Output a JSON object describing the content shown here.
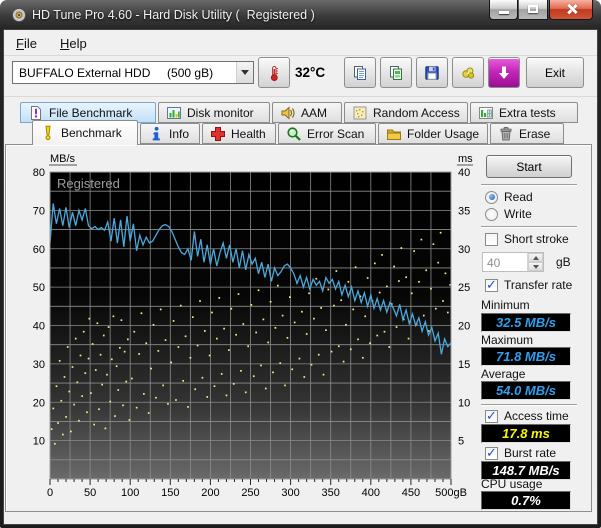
{
  "window": {
    "title": "HD Tune Pro 4.60 - Hard Disk Utility (  Registered )"
  },
  "menu": {
    "items": [
      {
        "label": "File"
      },
      {
        "label": "Help"
      }
    ]
  },
  "toolbar": {
    "drive_select": {
      "value": "BUFFALO External HDD     (500 gB)"
    },
    "temperature": "32°C",
    "exit_label": "Exit",
    "icons": [
      "thermometer-icon",
      "copy-icon",
      "copy-image-icon",
      "save-icon",
      "tools-icon",
      "download-icon"
    ]
  },
  "tabs_row1": [
    {
      "label": "File Benchmark",
      "icon": "file-benchmark-icon",
      "highlighted": true
    },
    {
      "label": "Disk monitor",
      "icon": "disk-monitor-icon"
    },
    {
      "label": "AAM",
      "icon": "speaker-icon"
    },
    {
      "label": "Random Access",
      "icon": "random-access-icon"
    },
    {
      "label": "Extra tests",
      "icon": "extra-tests-icon"
    }
  ],
  "tabs_row2": [
    {
      "label": "Benchmark",
      "icon": "exclamation-icon",
      "active": true
    },
    {
      "label": "Info",
      "icon": "info-icon"
    },
    {
      "label": "Health",
      "icon": "health-cross-icon"
    },
    {
      "label": "Error Scan",
      "icon": "magnifier-icon"
    },
    {
      "label": "Folder Usage",
      "icon": "folder-icon"
    },
    {
      "label": "Erase",
      "icon": "trash-icon"
    }
  ],
  "panel": {
    "start_label": "Start",
    "read_label": "Read",
    "write_label": "Write",
    "short_stroke_label": "Short stroke",
    "short_stroke_value": "40",
    "short_stroke_unit": "gB",
    "transfer_rate_label": "Transfer rate",
    "minimum_label": "Minimum",
    "minimum_value": "32.5 MB/s",
    "maximum_label": "Maximum",
    "maximum_value": "71.8 MB/s",
    "average_label": "Average",
    "average_value": "54.0 MB/s",
    "access_time_label": "Access time",
    "access_time_value": "17.8 ms",
    "burst_rate_label": "Burst rate",
    "burst_rate_value": "148.7 MB/s",
    "cpu_usage_label": "CPU usage",
    "cpu_usage_value": "0.7%"
  },
  "chart_data": {
    "type": "line+scatter",
    "watermark": "Registered",
    "left_axis": {
      "label": "MB/s",
      "min": 0,
      "max": 80,
      "ticks": [
        80,
        70,
        60,
        50,
        40,
        30,
        20,
        10
      ],
      "grid_step": 5
    },
    "right_axis": {
      "label": "ms",
      "min": 0,
      "max": 40,
      "ticks": [
        40,
        35,
        30,
        25,
        20,
        15,
        10,
        5
      ]
    },
    "x_axis": {
      "min": 0,
      "max": 500,
      "major_ticks": [
        0,
        50,
        100,
        150,
        200,
        250,
        300,
        350,
        400,
        450,
        500
      ],
      "labels": [
        "0",
        "50",
        "100",
        "150",
        "200",
        "250",
        "300",
        "350",
        "400",
        "450",
        "500gB"
      ],
      "minor_step": 10,
      "grid_step": 25
    },
    "series": [
      {
        "name": "transfer_rate",
        "type": "line",
        "axis": "left",
        "color": "#4aa9dd",
        "x_step": 4,
        "values": [
          61.5,
          71.8,
          66.5,
          70.5,
          66,
          70.8,
          65.5,
          69.5,
          66,
          70,
          67.5,
          70.5,
          66,
          65.2,
          65.8,
          65,
          65.5,
          64.8,
          67,
          62,
          68,
          61.5,
          67.5,
          60.5,
          68.5,
          62,
          66.5,
          59.5,
          63.5,
          61,
          63,
          61.5,
          62,
          63.5,
          65,
          66,
          66.3,
          65.8,
          64.5,
          62.5,
          60.5,
          59,
          58.5,
          60,
          57,
          64.5,
          58,
          62.5,
          56.5,
          61,
          56,
          60,
          55.5,
          59,
          61.5,
          57.5,
          61,
          56.5,
          60,
          55,
          59.5,
          54.5,
          58.5,
          56,
          57.5,
          53.5,
          56.5,
          52.5,
          56,
          51.5,
          55,
          53,
          54,
          55.5,
          56,
          55,
          53.5,
          51,
          53,
          50,
          52.5,
          49.5,
          52,
          50.5,
          51.5,
          49,
          52.5,
          51,
          52,
          49.5,
          51.5,
          48,
          50.5,
          47.5,
          50,
          46.5,
          49,
          46,
          48.5,
          45,
          48,
          44.5,
          47,
          44,
          46.5,
          43.5,
          46,
          44.5,
          42.5,
          45.5,
          41.5,
          44,
          40.5,
          43,
          40,
          42,
          38.5,
          41,
          37.5,
          39.5,
          36,
          38,
          32.5,
          36.5,
          34.5,
          35.5
        ]
      },
      {
        "name": "access_time",
        "type": "scatter",
        "axis": "right",
        "color": "#f2ee86",
        "points": [
          [
            2,
            6.5
          ],
          [
            4,
            9.2
          ],
          [
            6,
            4.6
          ],
          [
            8,
            12.1
          ],
          [
            10,
            7.3
          ],
          [
            12,
            15.4
          ],
          [
            14,
            10.2
          ],
          [
            16,
            5.8
          ],
          [
            18,
            13.3
          ],
          [
            20,
            8.1
          ],
          [
            22,
            17.2
          ],
          [
            24,
            11.4
          ],
          [
            26,
            6.2
          ],
          [
            28,
            14.6
          ],
          [
            30,
            9.7
          ],
          [
            32,
            18.3
          ],
          [
            34,
            12.6
          ],
          [
            36,
            7.6
          ],
          [
            38,
            16.1
          ],
          [
            40,
            10.8
          ],
          [
            42,
            19.2
          ],
          [
            44,
            13.8
          ],
          [
            46,
            8.7
          ],
          [
            48,
            15.7
          ],
          [
            49,
            20.9
          ],
          [
            51,
            11.2
          ],
          [
            53,
            17.6
          ],
          [
            55,
            7.1
          ],
          [
            57,
            14.2
          ],
          [
            59,
            20.3
          ],
          [
            61,
            9.1
          ],
          [
            63,
            16.2
          ],
          [
            65,
            12.3
          ],
          [
            67,
            18.7
          ],
          [
            69,
            6.6
          ],
          [
            71,
            13.6
          ],
          [
            73,
            19.8
          ],
          [
            75,
            10.1
          ],
          [
            77,
            15.6
          ],
          [
            79,
            21.2
          ],
          [
            81,
            8.2
          ],
          [
            83,
            14.7
          ],
          [
            85,
            11.6
          ],
          [
            87,
            17.1
          ],
          [
            89,
            20.7
          ],
          [
            91,
            9.6
          ],
          [
            93,
            16.6
          ],
          [
            95,
            12.7
          ],
          [
            97,
            18.2
          ],
          [
            99,
            7.7
          ],
          [
            102,
            13.1
          ],
          [
            105,
            19.2
          ],
          [
            108,
            9.3
          ],
          [
            111,
            16.3
          ],
          [
            114,
            21.6
          ],
          [
            117,
            11.1
          ],
          [
            120,
            17.7
          ],
          [
            123,
            8.6
          ],
          [
            126,
            14.4
          ],
          [
            129,
            20.1
          ],
          [
            132,
            10.6
          ],
          [
            135,
            16.7
          ],
          [
            138,
            22.1
          ],
          [
            141,
            12.2
          ],
          [
            144,
            18.1
          ],
          [
            147,
            9.8
          ],
          [
            151,
            15.2
          ],
          [
            154,
            20.6
          ],
          [
            157,
            10.3
          ],
          [
            160,
            17.2
          ],
          [
            163,
            22.6
          ],
          [
            166,
            12.8
          ],
          [
            169,
            18.6
          ],
          [
            172,
            9.4
          ],
          [
            175,
            15.8
          ],
          [
            178,
            21.1
          ],
          [
            181,
            11.7
          ],
          [
            184,
            17.4
          ],
          [
            187,
            23.2
          ],
          [
            190,
            13.2
          ],
          [
            193,
            19.3
          ],
          [
            196,
            10.7
          ],
          [
            199,
            16.1
          ],
          [
            202,
            21.7
          ],
          [
            205,
            12.1
          ],
          [
            208,
            18.3
          ],
          [
            211,
            23.6
          ],
          [
            214,
            13.7
          ],
          [
            217,
            19.6
          ],
          [
            220,
            10.9
          ],
          [
            223,
            16.8
          ],
          [
            226,
            22.2
          ],
          [
            229,
            12.4
          ],
          [
            232,
            18.8
          ],
          [
            235,
            24.1
          ],
          [
            238,
            14.1
          ],
          [
            241,
            20.2
          ],
          [
            244,
            11.3
          ],
          [
            247,
            17.3
          ],
          [
            251,
            22.7
          ],
          [
            254,
            13.4
          ],
          [
            257,
            19.1
          ],
          [
            260,
            24.6
          ],
          [
            263,
            14.8
          ],
          [
            266,
            20.8
          ],
          [
            269,
            11.8
          ],
          [
            272,
            17.8
          ],
          [
            275,
            23.1
          ],
          [
            278,
            13.9
          ],
          [
            281,
            19.7
          ],
          [
            284,
            25.2
          ],
          [
            287,
            15.1
          ],
          [
            290,
            21.3
          ],
          [
            293,
            12.2
          ],
          [
            296,
            18.4
          ],
          [
            299,
            23.7
          ],
          [
            302,
            14.3
          ],
          [
            305,
            20.4
          ],
          [
            308,
            25.6
          ],
          [
            311,
            15.7
          ],
          [
            314,
            21.8
          ],
          [
            317,
            13.3
          ],
          [
            320,
            18.9
          ],
          [
            323,
            24.2
          ],
          [
            326,
            14.9
          ],
          [
            329,
            20.9
          ],
          [
            332,
            26.1
          ],
          [
            335,
            16.2
          ],
          [
            338,
            22.3
          ],
          [
            341,
            13.6
          ],
          [
            344,
            19.4
          ],
          [
            347,
            24.7
          ],
          [
            351,
            16.6
          ],
          [
            354,
            22.6
          ],
          [
            357,
            27.1
          ],
          [
            360,
            17.3
          ],
          [
            363,
            23.3
          ],
          [
            366,
            15.3
          ],
          [
            369,
            20.1
          ],
          [
            372,
            25.7
          ],
          [
            375,
            16.9
          ],
          [
            378,
            22.1
          ],
          [
            381,
            27.6
          ],
          [
            384,
            18.2
          ],
          [
            387,
            23.8
          ],
          [
            390,
            15.8
          ],
          [
            393,
            21.2
          ],
          [
            396,
            26.2
          ],
          [
            399,
            17.7
          ],
          [
            402,
            23.2
          ],
          [
            405,
            28.1
          ],
          [
            408,
            18.7
          ],
          [
            411,
            24.3
          ],
          [
            414,
            29.2
          ],
          [
            417,
            19.2
          ],
          [
            420,
            25.1
          ],
          [
            423,
            17.2
          ],
          [
            426,
            22.8
          ],
          [
            429,
            27.7
          ],
          [
            432,
            19.8
          ],
          [
            435,
            25.8
          ],
          [
            438,
            30.1
          ],
          [
            441,
            20.8
          ],
          [
            444,
            26.3
          ],
          [
            447,
            18.3
          ],
          [
            451,
            24.2
          ],
          [
            454,
            29.7
          ],
          [
            457,
            20.2
          ],
          [
            460,
            25.7
          ],
          [
            463,
            31.2
          ],
          [
            466,
            21.3
          ],
          [
            469,
            27.2
          ],
          [
            472,
            19.3
          ],
          [
            475,
            24.8
          ],
          [
            478,
            30.6
          ],
          [
            481,
            22.2
          ],
          [
            484,
            28.2
          ],
          [
            487,
            32.1
          ],
          [
            490,
            23.2
          ],
          [
            493,
            26.8
          ],
          [
            496,
            21.7
          ],
          [
            499,
            25.3
          ]
        ]
      }
    ]
  }
}
